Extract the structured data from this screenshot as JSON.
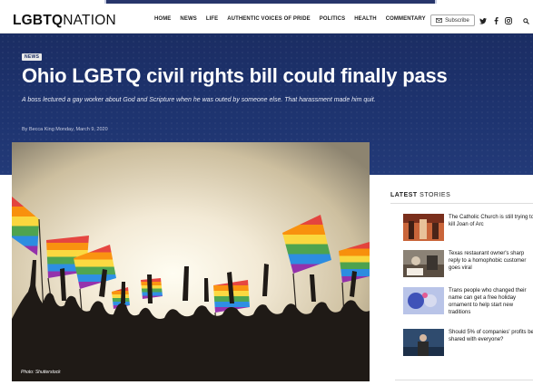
{
  "brand": {
    "logo_part1": "LGBTQ",
    "logo_part2": "NATION"
  },
  "nav": {
    "items": [
      "HOME",
      "NEWS",
      "LIFE",
      "AUTHENTIC VOICES OF PRIDE",
      "POLITICS",
      "HEALTH",
      "COMMENTARY"
    ]
  },
  "header": {
    "subscribe_label": "Subscribe",
    "icons": [
      "mail-icon",
      "twitter-icon",
      "facebook-icon",
      "instagram-icon",
      "search-icon"
    ]
  },
  "article": {
    "badge": "NEWS",
    "title": "Ohio LGBTQ civil rights bill could finally pass",
    "dek": "A boss lectured a gay worker about God and Scripture when he was outed by someone else. That harassment made him quit.",
    "byline": "By Becca King   Monday, March 9, 2020",
    "photo_caption": "Photo: Shutterstock"
  },
  "sidebar": {
    "heading_bold": "LATEST",
    "heading_rest": " STORIES",
    "stories": [
      {
        "title": "The Catholic Church is still trying to kill Joan of Arc"
      },
      {
        "title": "Texas restaurant owner's sharp reply to a homophobic customer goes viral"
      },
      {
        "title": "Trans people who changed their name can get a free holiday ornament to help start new traditions"
      },
      {
        "title": "Should 5% of companies' profits be shared with everyone?"
      }
    ]
  },
  "colors": {
    "hero_bg": "#1e3470",
    "badge_text": "#1b2d63",
    "accent_rainbow": [
      "#e53935",
      "#fb8c00",
      "#fdd835",
      "#43a047",
      "#1e88e5",
      "#8e24aa"
    ]
  }
}
